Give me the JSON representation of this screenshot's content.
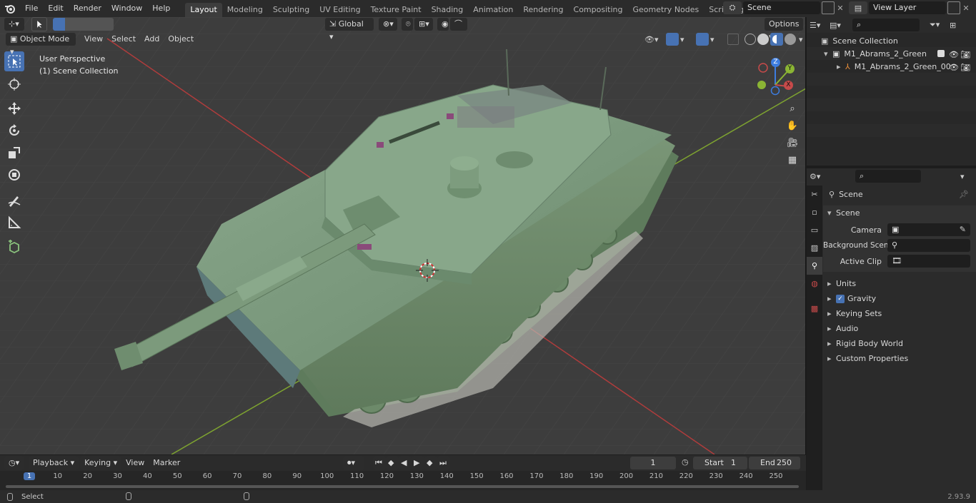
{
  "topbar": {
    "menus": [
      "File",
      "Edit",
      "Render",
      "Window",
      "Help"
    ],
    "workspaces": [
      "Layout",
      "Modeling",
      "Sculpting",
      "UV Editing",
      "Texture Paint",
      "Shading",
      "Animation",
      "Rendering",
      "Compositing",
      "Geometry Nodes",
      "Scripting"
    ],
    "active_workspace": "Layout",
    "scene_name": "Scene",
    "view_layer": "View Layer"
  },
  "viewport": {
    "transform_orientation": "Global",
    "options_label": "Options",
    "mode": "Object Mode",
    "menus": [
      "View",
      "Select",
      "Add",
      "Object"
    ],
    "overlay_title": "User Perspective",
    "overlay_subtitle": "(1) Scene Collection",
    "gizmo_axes": [
      "Z",
      "Y",
      "X"
    ]
  },
  "outliner": {
    "root": "Scene Collection",
    "items": [
      {
        "label": "M1_Abrams_2_Green"
      },
      {
        "label": "M1_Abrams_2_Green_00"
      }
    ]
  },
  "properties": {
    "context": "Scene",
    "section": "Scene",
    "fields": [
      {
        "label": "Camera",
        "value": ""
      },
      {
        "label": "Background Scene",
        "value": ""
      },
      {
        "label": "Active Clip",
        "value": ""
      }
    ],
    "subpanels": [
      "Units",
      "Gravity",
      "Keying Sets",
      "Audio",
      "Rigid Body World",
      "Custom Properties"
    ]
  },
  "timeline": {
    "menus": [
      "Playback",
      "Keying",
      "View",
      "Marker"
    ],
    "current_frame": "1",
    "start_label": "Start",
    "start": "1",
    "end_label": "End",
    "end": "250",
    "ruler": [
      "1",
      "10",
      "20",
      "30",
      "40",
      "50",
      "60",
      "70",
      "80",
      "90",
      "100",
      "110",
      "120",
      "130",
      "140",
      "150",
      "160",
      "170",
      "180",
      "190",
      "200",
      "210",
      "220",
      "230",
      "240",
      "250"
    ]
  },
  "statusbar": {
    "hint": "Select",
    "version": "2.93.9"
  },
  "colors": {
    "accent": "#4772b3",
    "x_axis": "#c74a4a",
    "y_axis": "#8bb534",
    "z_axis": "#3d7de0",
    "tank_body": "#7d9a7f"
  }
}
